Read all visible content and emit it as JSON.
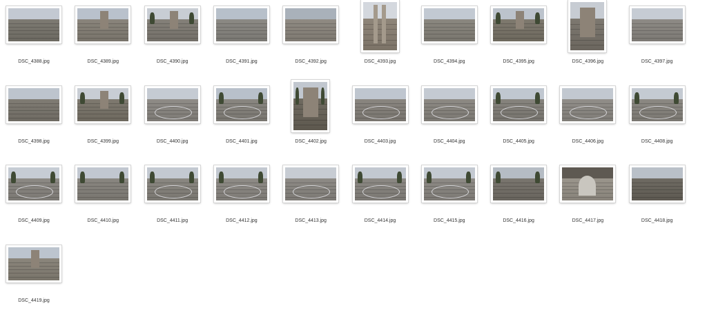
{
  "files": [
    {
      "name": "DSC_4388.jpg",
      "orientation": "landscape",
      "sky": "#c3c9d2",
      "ground": "#7e7b73",
      "features": [
        "ruins"
      ]
    },
    {
      "name": "DSC_4389.jpg",
      "orientation": "landscape",
      "sky": "#b9c1cc",
      "ground": "#8a857c",
      "features": [
        "ruins",
        "tower"
      ]
    },
    {
      "name": "DSC_4390.jpg",
      "orientation": "landscape",
      "sky": "#c8cdd4",
      "ground": "#85817a",
      "features": [
        "trees",
        "tower"
      ]
    },
    {
      "name": "DSC_4391.jpg",
      "orientation": "landscape",
      "sky": "#b7c0ca",
      "ground": "#8c8a85",
      "features": [
        "steps"
      ]
    },
    {
      "name": "DSC_4392.jpg",
      "orientation": "landscape",
      "sky": "#a9b1ba",
      "ground": "#908b83",
      "features": [
        "steps",
        "wall"
      ]
    },
    {
      "name": "DSC_4393.jpg",
      "orientation": "portrait",
      "sky": "#d4d8de",
      "ground": "#8e8579",
      "features": [
        "columns"
      ]
    },
    {
      "name": "DSC_4394.jpg",
      "orientation": "landscape",
      "sky": "#c2c9d2",
      "ground": "#8b8880",
      "features": [
        "steps"
      ]
    },
    {
      "name": "DSC_4395.jpg",
      "orientation": "landscape",
      "sky": "#bcc3cc",
      "ground": "#7f7a6f",
      "features": [
        "tower",
        "trees"
      ]
    },
    {
      "name": "DSC_4396.jpg",
      "orientation": "portrait",
      "sky": "#c7ccd3",
      "ground": "#7d7870",
      "features": [
        "tower"
      ]
    },
    {
      "name": "DSC_4397.jpg",
      "orientation": "landscape",
      "sky": "#c6ccd4",
      "ground": "#8e8b86",
      "features": [
        "steps"
      ]
    },
    {
      "name": "DSC_4398.jpg",
      "orientation": "landscape",
      "sky": "#bdc4cd",
      "ground": "#807c74",
      "features": [
        "steps"
      ]
    },
    {
      "name": "DSC_4399.jpg",
      "orientation": "landscape",
      "sky": "#c8cdd4",
      "ground": "#7f7a70",
      "features": [
        "tower",
        "trees"
      ]
    },
    {
      "name": "DSC_4400.jpg",
      "orientation": "landscape",
      "sky": "#c5cbd3",
      "ground": "#8f8c87",
      "features": [
        "arena"
      ]
    },
    {
      "name": "DSC_4401.jpg",
      "orientation": "landscape",
      "sky": "#b8c0ca",
      "ground": "#8a8781",
      "features": [
        "arena",
        "trees"
      ]
    },
    {
      "name": "DSC_4402.jpg",
      "orientation": "portrait",
      "sky": "#c1c7cf",
      "ground": "#6f6a60",
      "features": [
        "tower",
        "trees"
      ]
    },
    {
      "name": "DSC_4403.jpg",
      "orientation": "landscape",
      "sky": "#bfc6cf",
      "ground": "#8a8680",
      "features": [
        "arena"
      ]
    },
    {
      "name": "DSC_4404.jpg",
      "orientation": "landscape",
      "sky": "#c4cad2",
      "ground": "#8d8a84",
      "features": [
        "arena"
      ]
    },
    {
      "name": "DSC_4405.jpg",
      "orientation": "landscape",
      "sky": "#c0c7d0",
      "ground": "#87847e",
      "features": [
        "arena",
        "trees"
      ]
    },
    {
      "name": "DSC_4406.jpg",
      "orientation": "landscape",
      "sky": "#c2c8d0",
      "ground": "#918e89",
      "features": [
        "arena"
      ]
    },
    {
      "name": "DSC_4408.jpg",
      "orientation": "landscape",
      "sky": "#c4cad2",
      "ground": "#8c8983",
      "features": [
        "arena",
        "trees"
      ]
    },
    {
      "name": "DSC_4409.jpg",
      "orientation": "landscape",
      "sky": "#c6ccd4",
      "ground": "#8d8a85",
      "features": [
        "arena",
        "trees"
      ]
    },
    {
      "name": "DSC_4410.jpg",
      "orientation": "landscape",
      "sky": "#c1c7d0",
      "ground": "#8a8781",
      "features": [
        "steps",
        "trees"
      ]
    },
    {
      "name": "DSC_4411.jpg",
      "orientation": "landscape",
      "sky": "#c3c9d1",
      "ground": "#8b8882",
      "features": [
        "arena",
        "trees"
      ]
    },
    {
      "name": "DSC_4412.jpg",
      "orientation": "landscape",
      "sky": "#c2c8d0",
      "ground": "#8f8c87",
      "features": [
        "arena",
        "trees"
      ]
    },
    {
      "name": "DSC_4413.jpg",
      "orientation": "landscape",
      "sky": "#c7ccd3",
      "ground": "#8e8b86",
      "features": [
        "arena"
      ]
    },
    {
      "name": "DSC_4414.jpg",
      "orientation": "landscape",
      "sky": "#c2c8d0",
      "ground": "#8c8984",
      "features": [
        "arena",
        "trees"
      ]
    },
    {
      "name": "DSC_4415.jpg",
      "orientation": "landscape",
      "sky": "#c3c9d1",
      "ground": "#8e8b86",
      "features": [
        "arena",
        "trees"
      ]
    },
    {
      "name": "DSC_4416.jpg",
      "orientation": "landscape",
      "sky": "#b5bcc4",
      "ground": "#7a766f",
      "features": [
        "wall",
        "trees"
      ]
    },
    {
      "name": "DSC_4417.jpg",
      "orientation": "landscape",
      "sky": "#5e5952",
      "ground": "#9a958c",
      "features": [
        "arch"
      ]
    },
    {
      "name": "DSC_4418.jpg",
      "orientation": "landscape",
      "sky": "#b9c0c8",
      "ground": "#6f6b63",
      "features": [
        "wall"
      ]
    },
    {
      "name": "DSC_4419.jpg",
      "orientation": "landscape",
      "sky": "#bcc4ce",
      "ground": "#8b867c",
      "features": [
        "ruins",
        "tower"
      ]
    }
  ]
}
